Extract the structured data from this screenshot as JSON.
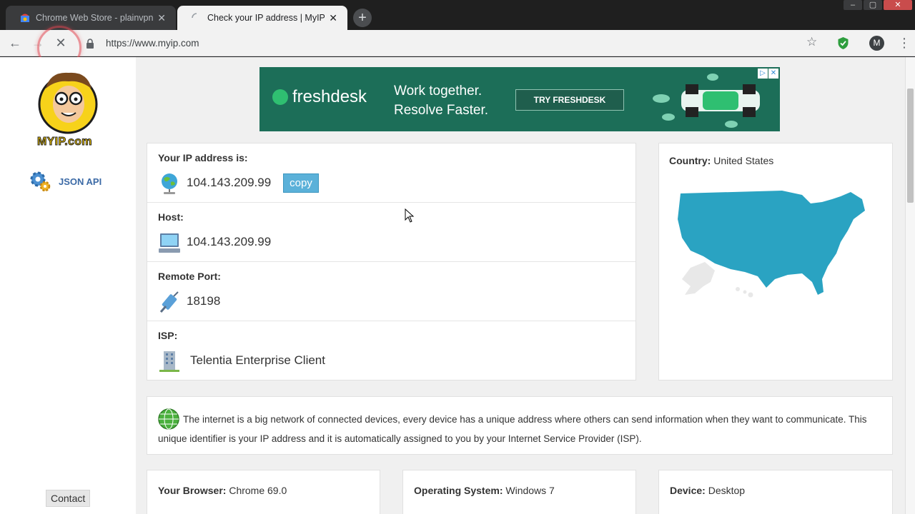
{
  "browser": {
    "tabs": [
      {
        "title": "Chrome Web Store - plainvpn",
        "active": false
      },
      {
        "title": "Check your IP address | MyIP.com",
        "active": true
      }
    ],
    "url": "https://www.myip.com",
    "profile_initial": "M"
  },
  "sidebar": {
    "logo_text": "MYIP.com",
    "json_api_label": "JSON API",
    "contact_label": "Contact"
  },
  "ad": {
    "brand": "freshdesk",
    "tagline_line1": "Work together.",
    "tagline_line2": "Resolve Faster.",
    "cta": "TRY FRESHDESK"
  },
  "ip_panel": {
    "ip_label": "Your IP address is:",
    "ip_value": "104.143.209.99",
    "copy_label": "copy",
    "host_label": "Host:",
    "host_value": "104.143.209.99",
    "port_label": "Remote Port:",
    "port_value": "18198",
    "isp_label": "ISP:",
    "isp_value": "Telentia Enterprise Client"
  },
  "country_panel": {
    "label": "Country:",
    "value": "United States",
    "map_color": "#2aa3c2"
  },
  "info": {
    "text": "The internet is a big network of connected devices, every device has a unique address where others can send information when they want to communicate. This unique identifier is your IP address and it is automatically assigned to you by your Internet Service Provider (ISP)."
  },
  "details": {
    "browser_label": "Your Browser:",
    "browser_value": "Chrome 69.0",
    "os_label": "Operating System:",
    "os_value": "Windows 7",
    "device_label": "Device:",
    "device_value": "Desktop"
  }
}
